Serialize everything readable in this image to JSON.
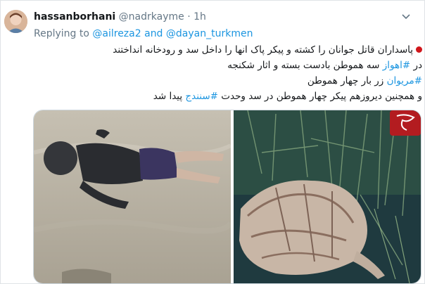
{
  "tweet": {
    "author_name": "hassanborhani",
    "author_handle": "@nadrkayme",
    "separator": "·",
    "time": "1h",
    "reply_prefix": "Replying to",
    "reply_user1": "@ailreza2",
    "reply_and": "and",
    "reply_user2": "@dayan_turkmen",
    "lines": [
      {
        "text": "پاسداران قاتل جوانان را کشته و پیکر پاک انها را داخل سد و رودخانه انداختند"
      },
      {
        "prefix": "در ",
        "tag": "#اهواز",
        "suffix": " سه هموطن  بادست بسته و اثار شکنجه"
      },
      {
        "prefix": "",
        "tag": "#مریوان",
        "suffix": " زر بار چهار هموطن"
      },
      {
        "prefix": "و همچنین دیروزهم پیکر چهار هموطن در سد وحدت ",
        "tag": "#سنندج",
        "suffix": " پیدا شد"
      }
    ]
  },
  "icons": {
    "menu": "chevron-down-icon",
    "watermark": "site-logo-watermark"
  },
  "colors": {
    "link": "#1b95e0",
    "muted": "#657786",
    "text": "#14171a",
    "bullet": "#d0161b"
  }
}
